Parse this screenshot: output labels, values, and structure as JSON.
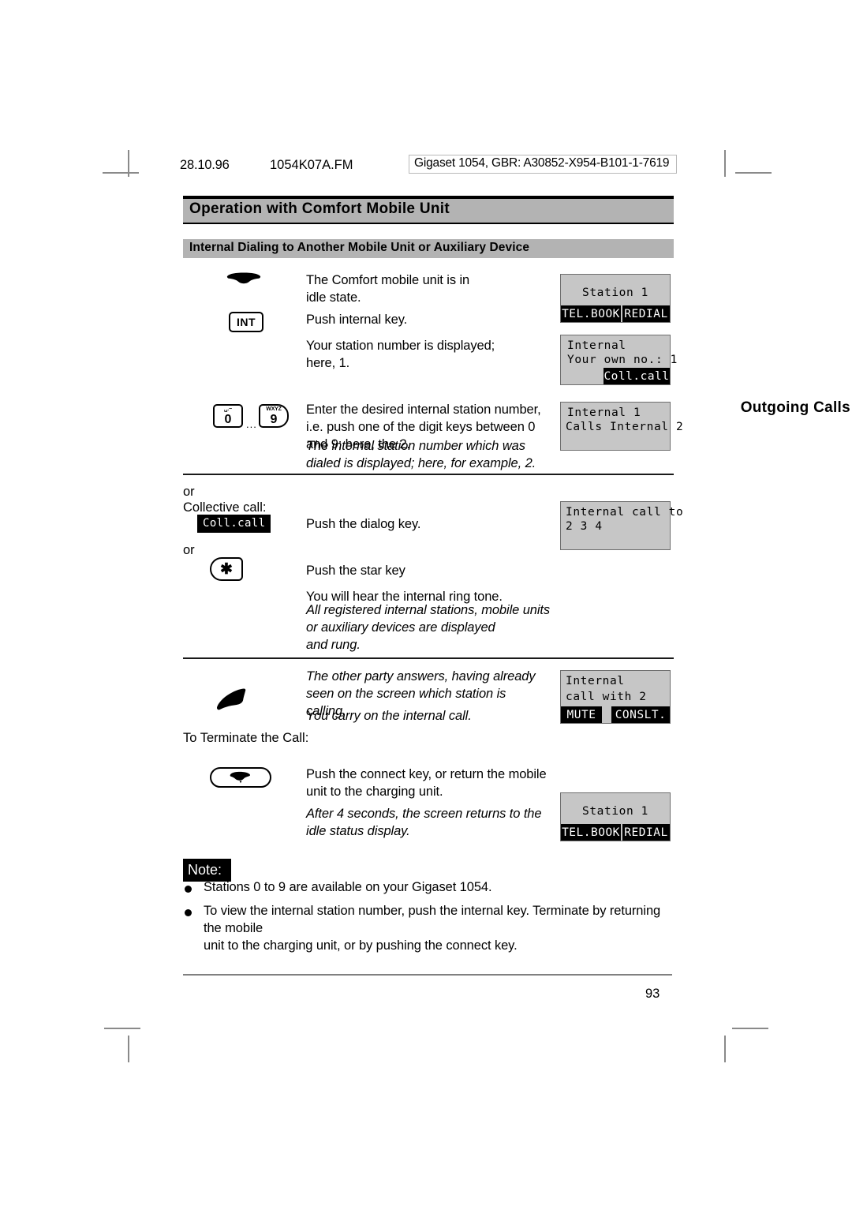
{
  "meta": {
    "date": "28.10.96",
    "filename": "1054K07A.FM",
    "doc_id": "Gigaset 1054, GBR: A30852-X954-B101-1-7619"
  },
  "running_head": {
    "left": "Operation with Comfort Mobile Unit",
    "right": "Outgoing Calls"
  },
  "section": {
    "title": "Internal Dialing to Another Mobile Unit or Auxiliary Device"
  },
  "steps": [
    {
      "icon": "handset-idle-icon",
      "text": "The Comfort mobile unit is in\nidle state."
    },
    {
      "icon": "int-key",
      "key_label": "INT",
      "text": "Push internal key."
    },
    {
      "icon": "none",
      "text": "Your station number is displayed;\nhere, 1."
    },
    {
      "icon": "digit-keys",
      "text": "Enter the desired internal station number,\ni.e. push one of the digit keys between 0\nand 9; here, the 2.",
      "text_italic": "The internal station number which was\ndialed is displayed; here, for example, 2."
    }
  ],
  "digit_keys": {
    "zero_label": "0",
    "zero_sub": "␣.−",
    "nine_label": "9",
    "nine_sub": "WXYZ",
    "ellipsis": "..."
  },
  "alt_block": {
    "or_1": "or",
    "collective_call_label": "Collective call:",
    "dialog_key_token": "Coll.call",
    "dialog_key_text": "Push the dialog key.",
    "or_2": "or",
    "star_key_glyph": "✱",
    "star_key_text": "Push the star key",
    "ring_tone_text": "You will hear the internal ring tone.",
    "ring_tone_italic": "All registered internal stations, mobile units\nor auxiliary devices are displayed\nand rung."
  },
  "answer_block": {
    "icon": "handset-pickup-icon",
    "italic_1": "The other party answers, having already\nseen on the screen which station is\ncalling.",
    "italic_2": "You carry on the internal call."
  },
  "terminate_block": {
    "heading": "To Terminate the Call:",
    "icon": "connect-key-icon",
    "text": "Push the connect key, or return the mobile\nunit to the charging unit.",
    "italic": "After 4 seconds, the screen returns to the\nidle status display."
  },
  "displays": [
    {
      "name": "idle-status-display",
      "lines": [
        {
          "text": "Station 1",
          "align": "center"
        }
      ],
      "softkeys": [
        {
          "label": "TEL.BOOK",
          "position": "left"
        },
        {
          "label": "REDIAL",
          "position": "right"
        }
      ]
    },
    {
      "name": "internal-own-number-display",
      "lines": [
        {
          "text": "Internal",
          "align": "left"
        },
        {
          "text": "Your own no.: 1",
          "align": "left"
        }
      ],
      "softkeys": [
        {
          "label": "Coll.call",
          "position": "right"
        }
      ]
    },
    {
      "name": "internal-calls-display",
      "lines": [
        {
          "text": "Internal 1",
          "align": "left"
        },
        {
          "text": "Calls Internal 2",
          "align": "left"
        }
      ],
      "softkeys": []
    },
    {
      "name": "internal-call-to-display",
      "lines": [
        {
          "text": "Internal call to",
          "align": "left"
        },
        {
          "text": "2 3 4",
          "align": "left"
        }
      ],
      "softkeys": []
    },
    {
      "name": "internal-call-with-display",
      "lines": [
        {
          "text": "Internal",
          "align": "left"
        },
        {
          "text": "call with 2",
          "align": "left"
        }
      ],
      "softkeys": [
        {
          "label": "MUTE",
          "position": "left"
        },
        {
          "label": "CONSLT.",
          "position": "right"
        }
      ]
    },
    {
      "name": "idle-status-display-end",
      "lines": [
        {
          "text": "Station 1",
          "align": "center"
        }
      ],
      "softkeys": [
        {
          "label": "TEL.BOOK",
          "position": "left"
        },
        {
          "label": "REDIAL",
          "position": "right"
        }
      ]
    }
  ],
  "note": {
    "badge": "Note:",
    "items": [
      "Stations 0 to 9 are available on your Gigaset 1054.",
      "To view the internal station number, push the internal key. Terminate by returning the mobile\nunit to the charging unit, or by pushing the connect key."
    ]
  },
  "footer": {
    "page_number": "93"
  },
  "colors": {
    "band_gray": "#b3b3b3",
    "lcd_gray": "#c6c6c6",
    "lcd_border": "#6e6e6e",
    "black": "#000000",
    "rule_gray": "#808080"
  }
}
